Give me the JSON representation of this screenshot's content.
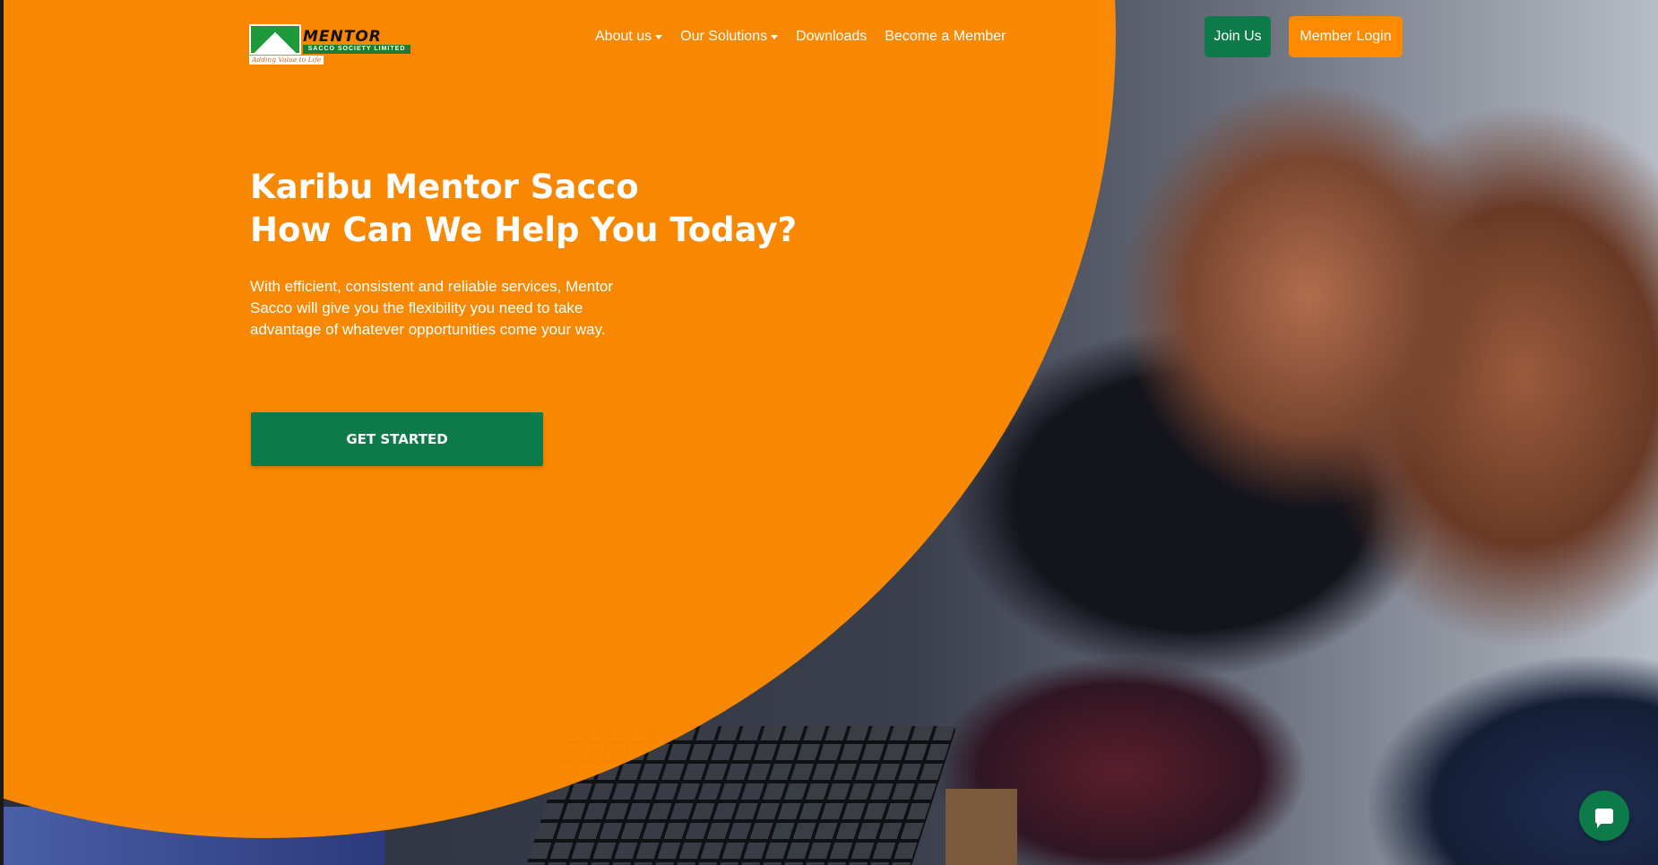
{
  "brand": {
    "logo_word": "MENTOR",
    "logo_subtitle": "SACCO SOCIETY LIMITED",
    "logo_tagline": "Adding Value to Life"
  },
  "nav": {
    "items": [
      {
        "label": "About us",
        "dropdown": true
      },
      {
        "label": "Our Solutions",
        "dropdown": true
      },
      {
        "label": "Downloads",
        "dropdown": false
      },
      {
        "label": "Become a Member",
        "dropdown": false
      }
    ],
    "join_label": "Join Us",
    "login_label": "Member Login"
  },
  "hero": {
    "title_line1": "Karibu Mentor Sacco",
    "title_line2": "How Can We Help You Today?",
    "description": "With efficient, consistent and reliable services, Mentor Sacco will give you the flexibility you need to take advantage of whatever opportunities come your way.",
    "cta_label": "GET STARTED"
  },
  "chat": {
    "icon": "chat-bubble-icon"
  },
  "colors": {
    "primary_orange": "#ff8a00",
    "primary_green": "#0d7a4a",
    "text_light": "#ffffff"
  }
}
